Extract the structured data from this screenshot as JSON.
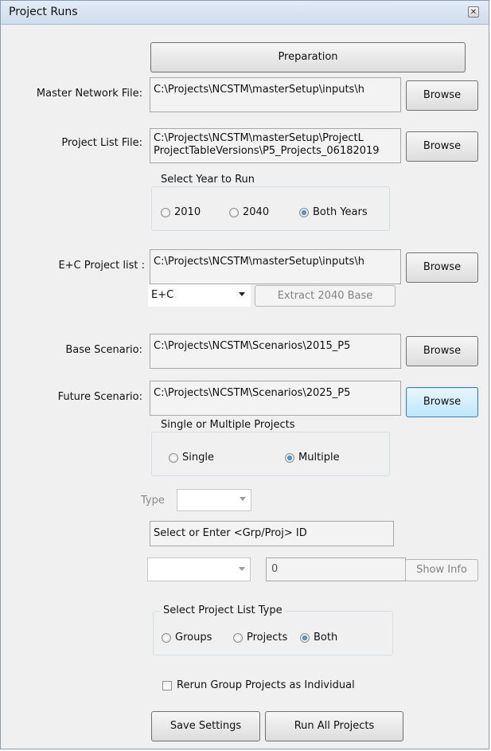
{
  "window": {
    "title": "Project  Runs",
    "close_glyph": "✕"
  },
  "preparation_button": "Preparation",
  "master_network": {
    "label": "Master Network File:",
    "value": "C:\\Projects\\NCSTM\\masterSetup\\inputs\\h",
    "browse": "Browse"
  },
  "project_list_file": {
    "label": "Project List File:",
    "line1": "C:\\Projects\\NCSTM\\masterSetup\\ProjectL",
    "line2": "ProjectTableVersions\\P5_Projects_06182019",
    "browse": "Browse"
  },
  "year_group": {
    "legend": "Select Year to Run",
    "options": [
      "2010",
      "2040",
      "Both Years"
    ],
    "selected": "Both Years"
  },
  "ec_project_list": {
    "label": "E+C Project list :",
    "value": "C:\\Projects\\NCSTM\\masterSetup\\inputs\\h",
    "browse": "Browse",
    "dropdown_value": "E+C",
    "extract_button": "Extract 2040 Base"
  },
  "base_scenario": {
    "label": "Base Scenario:",
    "value": "C:\\Projects\\NCSTM\\Scenarios\\2015_P5",
    "browse": "Browse"
  },
  "future_scenario": {
    "label": "Future Scenario:",
    "value": "C:\\Projects\\NCSTM\\Scenarios\\2025_P5",
    "browse": "Browse"
  },
  "single_multiple_group": {
    "legend": "Single or Multiple Projects",
    "options": [
      "Single",
      "Multiple"
    ],
    "selected": "Multiple"
  },
  "type_field": {
    "label": "Type",
    "value": ""
  },
  "grp_proj_prompt": "Select or Enter <Grp/Proj> ID",
  "id_dropdown_value": "",
  "id_value_field": "0",
  "show_info_button": "Show Info",
  "list_type_group": {
    "legend": "Select Project List Type",
    "options": [
      "Groups",
      "Projects",
      "Both"
    ],
    "selected": "Both"
  },
  "rerun_checkbox": {
    "label": "Rerun Group Projects as Individual",
    "checked": false
  },
  "save_settings_button": "Save Settings",
  "run_all_button": "Run All Projects"
}
